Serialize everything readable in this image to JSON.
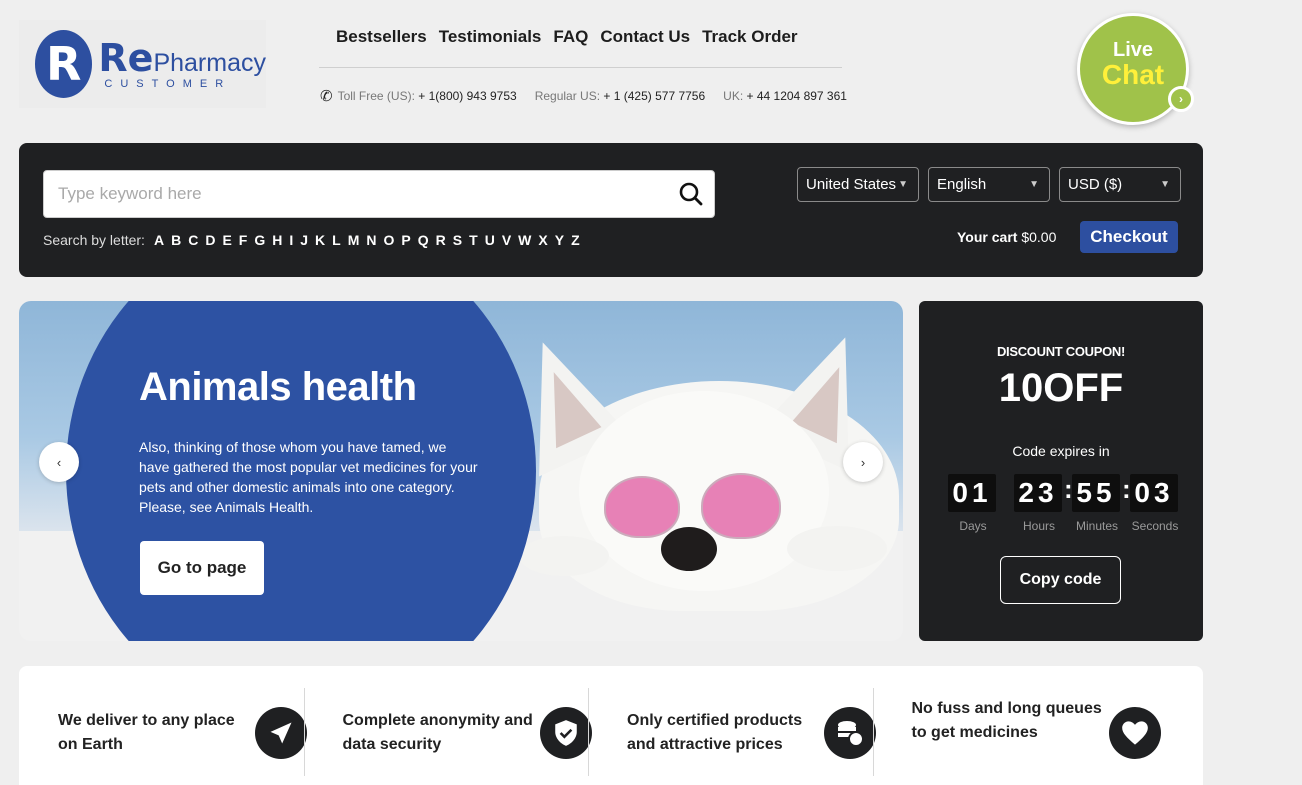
{
  "brand": {
    "logo_letter": "R",
    "name_part1": "Re",
    "name_part2": "Pharmacy",
    "sub": "CUSTOMER"
  },
  "nav": {
    "items": [
      "Bestsellers",
      "Testimonials",
      "FAQ",
      "Contact Us",
      "Track Order"
    ]
  },
  "phones": {
    "toll_free_label": "Toll Free (US):",
    "toll_free": "+ 1(800) 943 9753",
    "regular_label": "Regular US:",
    "regular": "+ 1 (425) 577 7756",
    "uk_label": "UK:",
    "uk": "+ 44 1204 897 361"
  },
  "live_chat": {
    "line1": "Live",
    "line2": "Chat",
    "arrow": "›"
  },
  "search": {
    "placeholder": "Type keyword here",
    "letters_label": "Search by letter:",
    "letters": [
      "A",
      "B",
      "C",
      "D",
      "E",
      "F",
      "G",
      "H",
      "I",
      "J",
      "K",
      "L",
      "M",
      "N",
      "O",
      "P",
      "Q",
      "R",
      "S",
      "T",
      "U",
      "V",
      "W",
      "X",
      "Y",
      "Z"
    ]
  },
  "selects": {
    "country": "United States",
    "language": "English",
    "currency": "USD ($)"
  },
  "cart": {
    "label": "Your cart",
    "amount": "$0.00",
    "checkout": "Checkout"
  },
  "hero": {
    "title": "Animals health",
    "text": "Also, thinking of those whom you have tamed, we have gathered the most popular vet medicines for your pets and other domestic animals into one category. Please, see Animals Health.",
    "button": "Go to page",
    "prev": "‹",
    "next": "›"
  },
  "coupon": {
    "title": "DISCOUNT COUPON!",
    "code": "10OFF",
    "expires": "Code expires in",
    "timer": {
      "days": "01",
      "hours": "23",
      "minutes": "55",
      "seconds": "03",
      "days_label": "Days",
      "hours_label": "Hours",
      "minutes_label": "Minutes",
      "seconds_label": "Seconds"
    },
    "copy_button": "Copy code"
  },
  "features": [
    {
      "text": "We deliver to any place on Earth",
      "icon": "plane-icon"
    },
    {
      "text": "Complete anonymity and data security",
      "icon": "shield-check-icon"
    },
    {
      "text": "Only certified products and attractive prices",
      "icon": "coins-icon"
    },
    {
      "text": "No fuss and long queues to get medicines",
      "icon": "heart-icon"
    }
  ],
  "colors": {
    "brand_blue": "#2d4fa0",
    "dark_panel": "#1f2022",
    "live_chat_green": "#a0c24a",
    "live_chat_yellow": "#fff03a"
  }
}
